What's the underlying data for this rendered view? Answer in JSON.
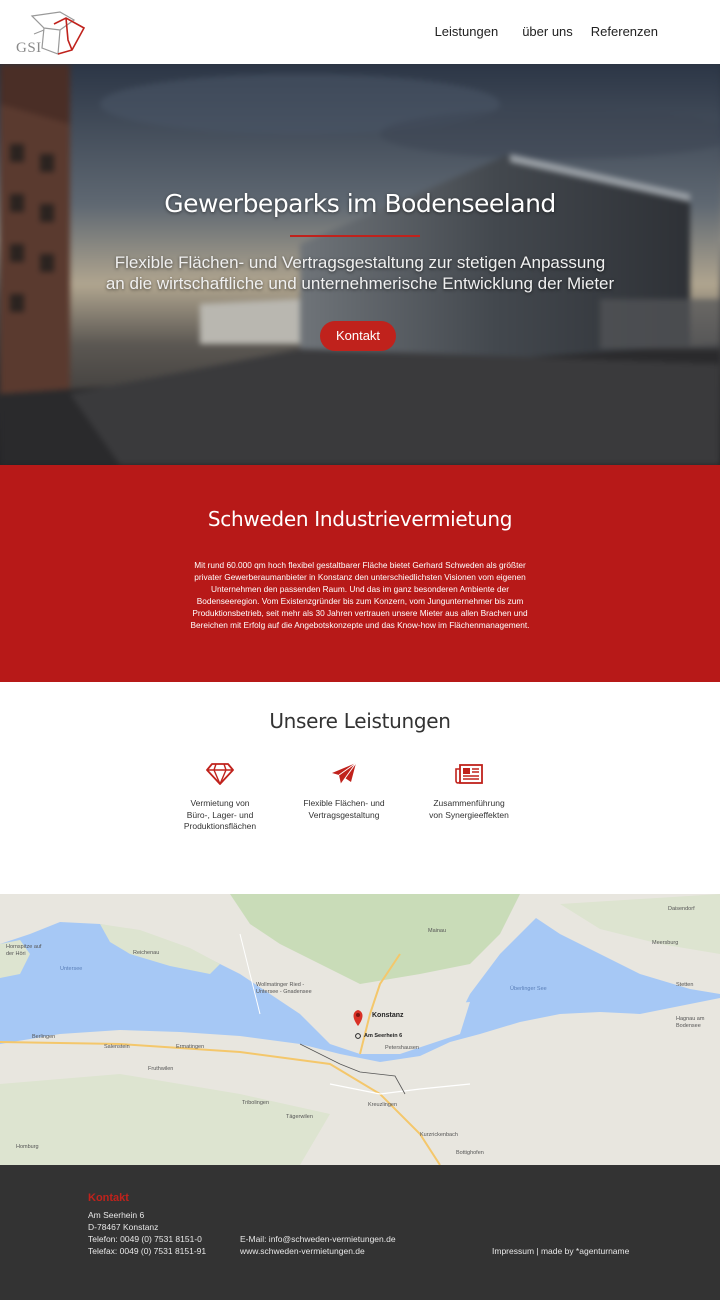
{
  "header": {
    "logo_text": "GSI",
    "nav": [
      "Leistungen",
      "über uns",
      "Referenzen"
    ]
  },
  "hero": {
    "title": "Gewerbeparks im Bodenseeland",
    "subtitle_line1": "Flexible Flächen- und Vertragsgestaltung zur  stetigen Anpassung",
    "subtitle_line2": "an die wirtschaftliche und  unternehmerische Entwicklung der Mieter",
    "button": "Kontakt"
  },
  "about": {
    "title": "Schweden Industrievermietung",
    "text": "Mit rund 60.000 qm hoch flexibel gestaltbarer Fläche bietet Gerhard Schweden als größter privater Gewerberaumanbieter in Konstanz den unterschiedlichsten Visionen vom eigenen Unternehmen den passenden Raum. Und das im ganz besonderen Ambiente der Bodenseeregion. Vom Existenzgründer bis zum Konzern, vom Jungunternehmer bis zum Produktionsbetrieb, seit mehr als 30 Jahren vertrauen unsere Mieter aus allen Brachen und Bereichen mit Erfolg auf die Angebotskonzepte und das Know-how im Flächenmanagement."
  },
  "services": {
    "title": "Unsere Leistungen",
    "items": [
      {
        "icon": "diamond-icon",
        "lines": [
          "Vermietung von",
          "Büro-, Lager- und",
          "Produktionsflächen"
        ]
      },
      {
        "icon": "paper-plane-icon",
        "lines": [
          "Flexible Flächen- und",
          "Vertragsgestaltung"
        ]
      },
      {
        "icon": "newspaper-icon",
        "lines": [
          "Zusammenführung",
          "von Synergieeffekten"
        ]
      }
    ]
  },
  "map": {
    "marker_label": "Am Seerhein 6",
    "places": [
      "Konstanz",
      "Reichenau",
      "Mainau",
      "Meersburg",
      "Kreuzlingen",
      "Petershausen",
      "Wollmatinger Ried - Untersee - Gnadensee",
      "Homburg",
      "Tägerwilen",
      "Tribolingen",
      "Ermatingen",
      "Salenstein",
      "Berlingen",
      "Fruthwilen",
      "Kurzrickenbach",
      "Bottighofen",
      "Hagnau am Bodensee",
      "Stetten",
      "Daisendorf",
      "Hornspitze auf der Höri",
      "Untersee",
      "Überlinger See"
    ],
    "water_color": "#a6c8f5",
    "land_color": "#e8e6df"
  },
  "footer": {
    "contact_title": "Kontakt",
    "street": "Am Seerhein 6",
    "city": "D-78467 Konstanz",
    "phone": "Telefon: 0049 (0) 7531 8151-0",
    "fax": "Telefax: 0049 (0) 7531 8151-91",
    "email": "E-Mail: info@schweden-vermietungen.de",
    "web": "www.schweden-vermietungen.de",
    "legal": "Impressum | made by *agenturname"
  },
  "colors": {
    "accent": "#c0221c",
    "red_section": "#b71918",
    "footer_bg": "#333333"
  }
}
